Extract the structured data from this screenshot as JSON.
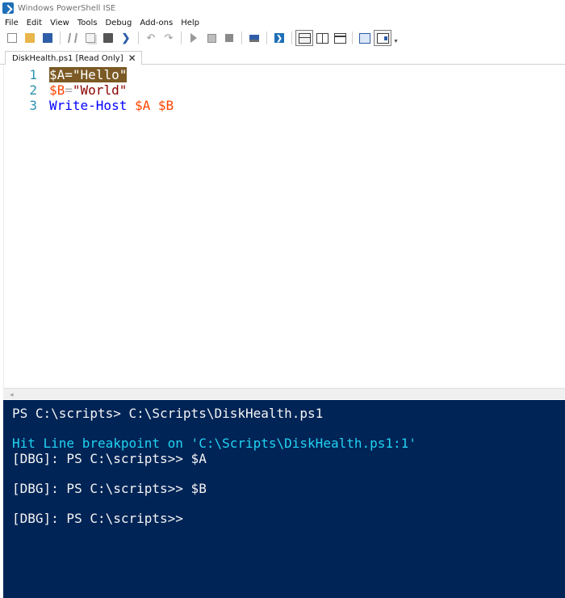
{
  "window": {
    "title": "Windows PowerShell ISE"
  },
  "menu": [
    "File",
    "Edit",
    "View",
    "Tools",
    "Debug",
    "Add-ons",
    "Help"
  ],
  "toolbar": {
    "icons": [
      "new-file-icon",
      "open-folder-icon",
      "save-icon",
      "cut-icon",
      "copy-icon",
      "paste-icon",
      "clear-console-icon",
      "undo-icon",
      "redo-icon",
      "run-script-icon",
      "run-selection-icon",
      "stop-icon",
      "new-remote-tab-icon",
      "start-powershell-icon",
      "script-pane-top-icon",
      "script-pane-right-icon",
      "script-pane-maximized-icon",
      "command-window-icon",
      "addon-tools-icon"
    ]
  },
  "tab": {
    "label": "DiskHealth.ps1 [Read Only]",
    "close": "✕"
  },
  "script": {
    "lines": [
      {
        "number": "1",
        "var": "$A",
        "op": "=",
        "str": "\"Hello\""
      },
      {
        "number": "2",
        "var": "$B",
        "op": "=",
        "str": "\"World\""
      },
      {
        "number": "3",
        "cmd": "Write-Host",
        "arg1": "$A",
        "arg2": "$B"
      }
    ]
  },
  "console": {
    "lines": [
      "PS C:\\scripts> C:\\Scripts\\DiskHealth.ps1",
      "",
      "Hit Line breakpoint on 'C:\\Scripts\\DiskHealth.ps1:1'",
      "[DBG]: PS C:\\scripts>> $A",
      "",
      "[DBG]: PS C:\\scripts>> $B",
      "",
      "[DBG]: PS C:\\scripts>>"
    ]
  },
  "colors": {
    "console_bg": "#012456",
    "breakpoint_highlight": "#7b5a25",
    "variable": "#ff4500",
    "string": "#8b0000",
    "cmdlet": "#0000ff",
    "line_number": "#2b91af",
    "debug_message": "#22d3f2"
  }
}
